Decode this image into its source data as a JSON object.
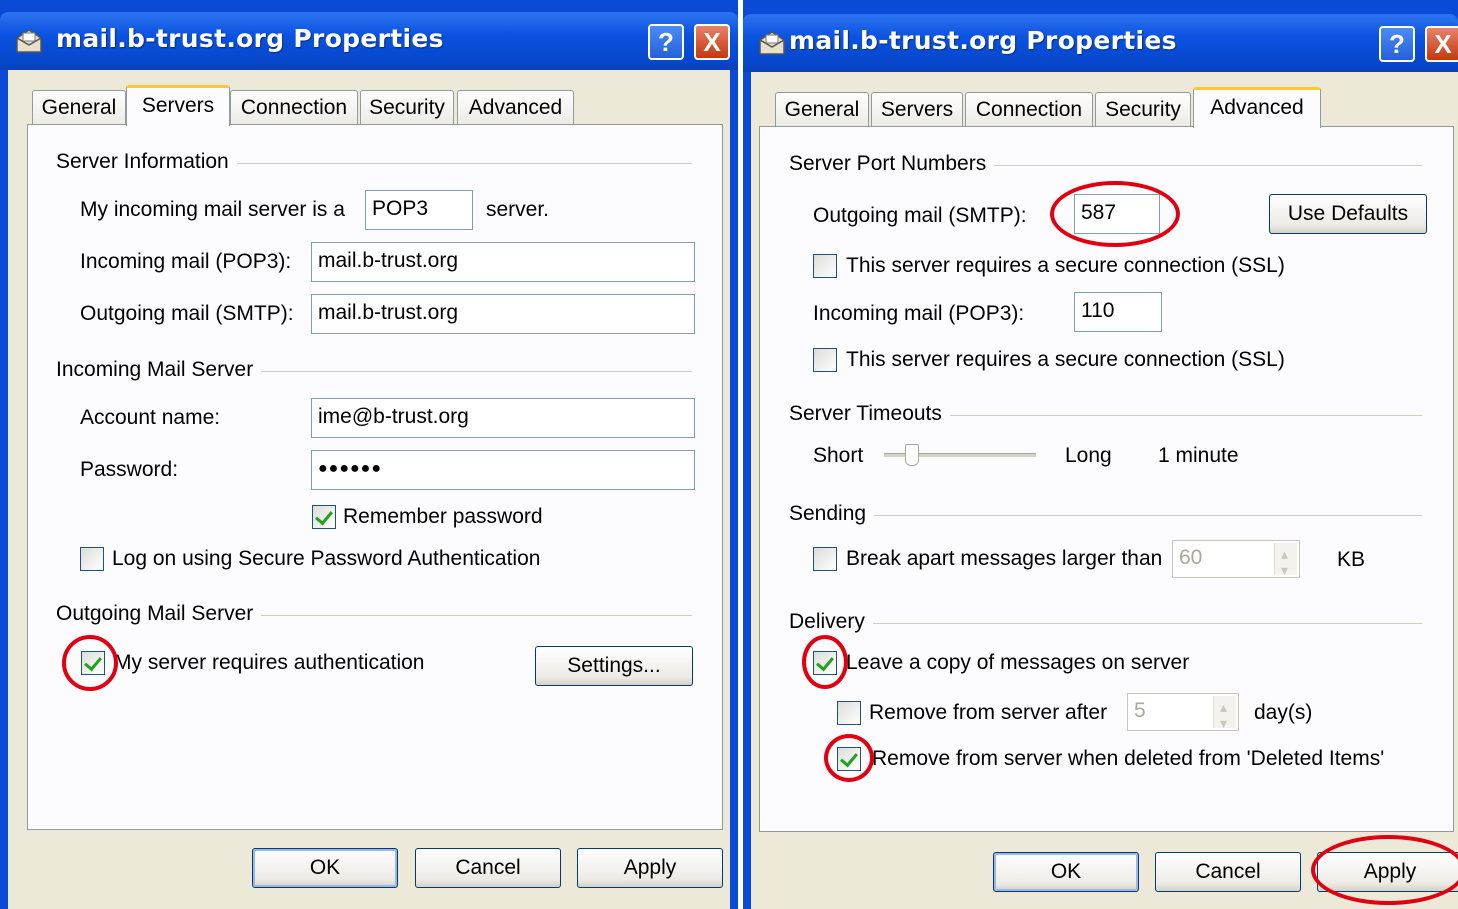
{
  "left": {
    "title": "mail.b-trust.org Properties",
    "help_glyph": "?",
    "close_glyph": "X",
    "tabs": [
      "General",
      "Servers",
      "Connection",
      "Security",
      "Advanced"
    ],
    "active_tab": "Servers",
    "server_info": {
      "group": "Server Information",
      "incoming_prefix": "My incoming mail server is a",
      "incoming_type": "POP3",
      "incoming_suffix": "server.",
      "incoming_label": "Incoming mail (POP3):",
      "incoming_value": "mail.b-trust.org",
      "outgoing_label": "Outgoing mail (SMTP):",
      "outgoing_value": "mail.b-trust.org"
    },
    "incoming_server": {
      "group": "Incoming Mail Server",
      "account_label": "Account name:",
      "account_value": "ime@b-trust.org",
      "password_label": "Password:",
      "password_value": "●●●●●●",
      "remember_label": "Remember password",
      "remember_checked": true,
      "spa_label": "Log on using Secure Password Authentication",
      "spa_checked": false
    },
    "outgoing_server": {
      "group": "Outgoing Mail Server",
      "auth_label": "My server requires authentication",
      "auth_checked": true,
      "settings_label": "Settings..."
    },
    "buttons": {
      "ok": "OK",
      "cancel": "Cancel",
      "apply": "Apply"
    }
  },
  "right": {
    "title": "mail.b-trust.org Properties",
    "help_glyph": "?",
    "close_glyph": "X",
    "tabs": [
      "General",
      "Servers",
      "Connection",
      "Security",
      "Advanced"
    ],
    "active_tab": "Advanced",
    "ports": {
      "group": "Server Port Numbers",
      "smtp_label": "Outgoing mail (SMTP):",
      "smtp_value": "587",
      "use_defaults": "Use Defaults",
      "smtp_ssl_label": "This server requires a secure connection (SSL)",
      "smtp_ssl_checked": false,
      "pop3_label": "Incoming mail (POP3):",
      "pop3_value": "110",
      "pop3_ssl_label": "This server requires a secure connection (SSL)",
      "pop3_ssl_checked": false
    },
    "timeouts": {
      "group": "Server Timeouts",
      "short": "Short",
      "long": "Long",
      "value": "1 minute",
      "slider_level": 0.15
    },
    "sending": {
      "group": "Sending",
      "break_label": "Break apart messages larger than",
      "break_checked": false,
      "break_value": "60",
      "unit": "KB"
    },
    "delivery": {
      "group": "Delivery",
      "leave_copy_label": "Leave a copy of messages on server",
      "leave_copy_checked": true,
      "remove_after_label": "Remove from server after",
      "remove_after_checked": false,
      "remove_after_value": "5",
      "days_label": "day(s)",
      "remove_deleted_label": "Remove from server when deleted from 'Deleted Items'",
      "remove_deleted_checked": true
    },
    "buttons": {
      "ok": "OK",
      "cancel": "Cancel",
      "apply": "Apply"
    }
  },
  "colors": {
    "title_blue": "#0a52e0",
    "dialog_bg": "#ece9d8",
    "highlight_red": "#e00010",
    "check_green": "#21a121"
  }
}
